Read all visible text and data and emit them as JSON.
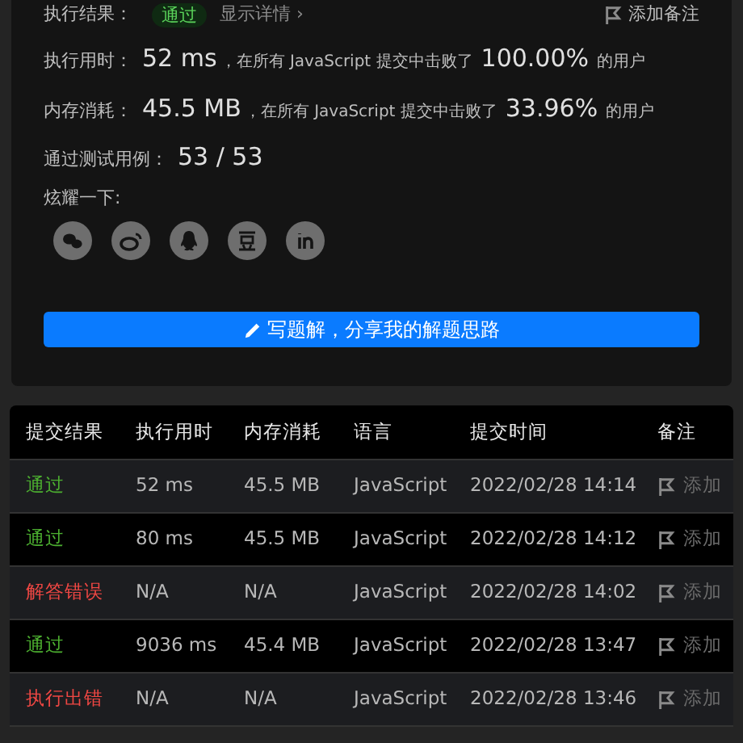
{
  "result": {
    "label": "执行结果：",
    "status": "通过",
    "details_link": "显示详情 ›",
    "note_button": "添加备注"
  },
  "stats": [
    {
      "label": "执行用时：",
      "value": "52 ms",
      "middle": "，在所有 JavaScript 提交中击败了",
      "percent": "100.00%",
      "suffix": "的用户"
    },
    {
      "label": "内存消耗：",
      "value": "45.5 MB",
      "middle": "，在所有 JavaScript 提交中击败了",
      "percent": "33.96%",
      "suffix": "的用户"
    }
  ],
  "test_cases": {
    "label": "通过测试用例：",
    "value": "53 / 53"
  },
  "share": {
    "label": "炫耀一下:"
  },
  "write_solution_button": "写题解，分享我的解题思路",
  "table": {
    "columns": [
      "提交结果",
      "执行用时",
      "内存消耗",
      "语言",
      "提交时间",
      "备注"
    ],
    "rows": [
      {
        "status": "通过",
        "kind": "pass",
        "time": "52 ms",
        "memory": "45.5 MB",
        "language": "JavaScript",
        "submitted": "2022/02/28 14:14",
        "note": "添加"
      },
      {
        "status": "通过",
        "kind": "pass",
        "time": "80 ms",
        "memory": "45.5 MB",
        "language": "JavaScript",
        "submitted": "2022/02/28 14:12",
        "note": "添加"
      },
      {
        "status": "解答错误",
        "kind": "fail",
        "time": "N/A",
        "memory": "N/A",
        "language": "JavaScript",
        "submitted": "2022/02/28 14:02",
        "note": "添加"
      },
      {
        "status": "通过",
        "kind": "pass",
        "time": "9036 ms",
        "memory": "45.4 MB",
        "language": "JavaScript",
        "submitted": "2022/02/28 13:47",
        "note": "添加"
      },
      {
        "status": "执行出错",
        "kind": "fail",
        "time": "N/A",
        "memory": "N/A",
        "language": "JavaScript",
        "submitted": "2022/02/28 13:46",
        "note": "添加"
      }
    ]
  }
}
